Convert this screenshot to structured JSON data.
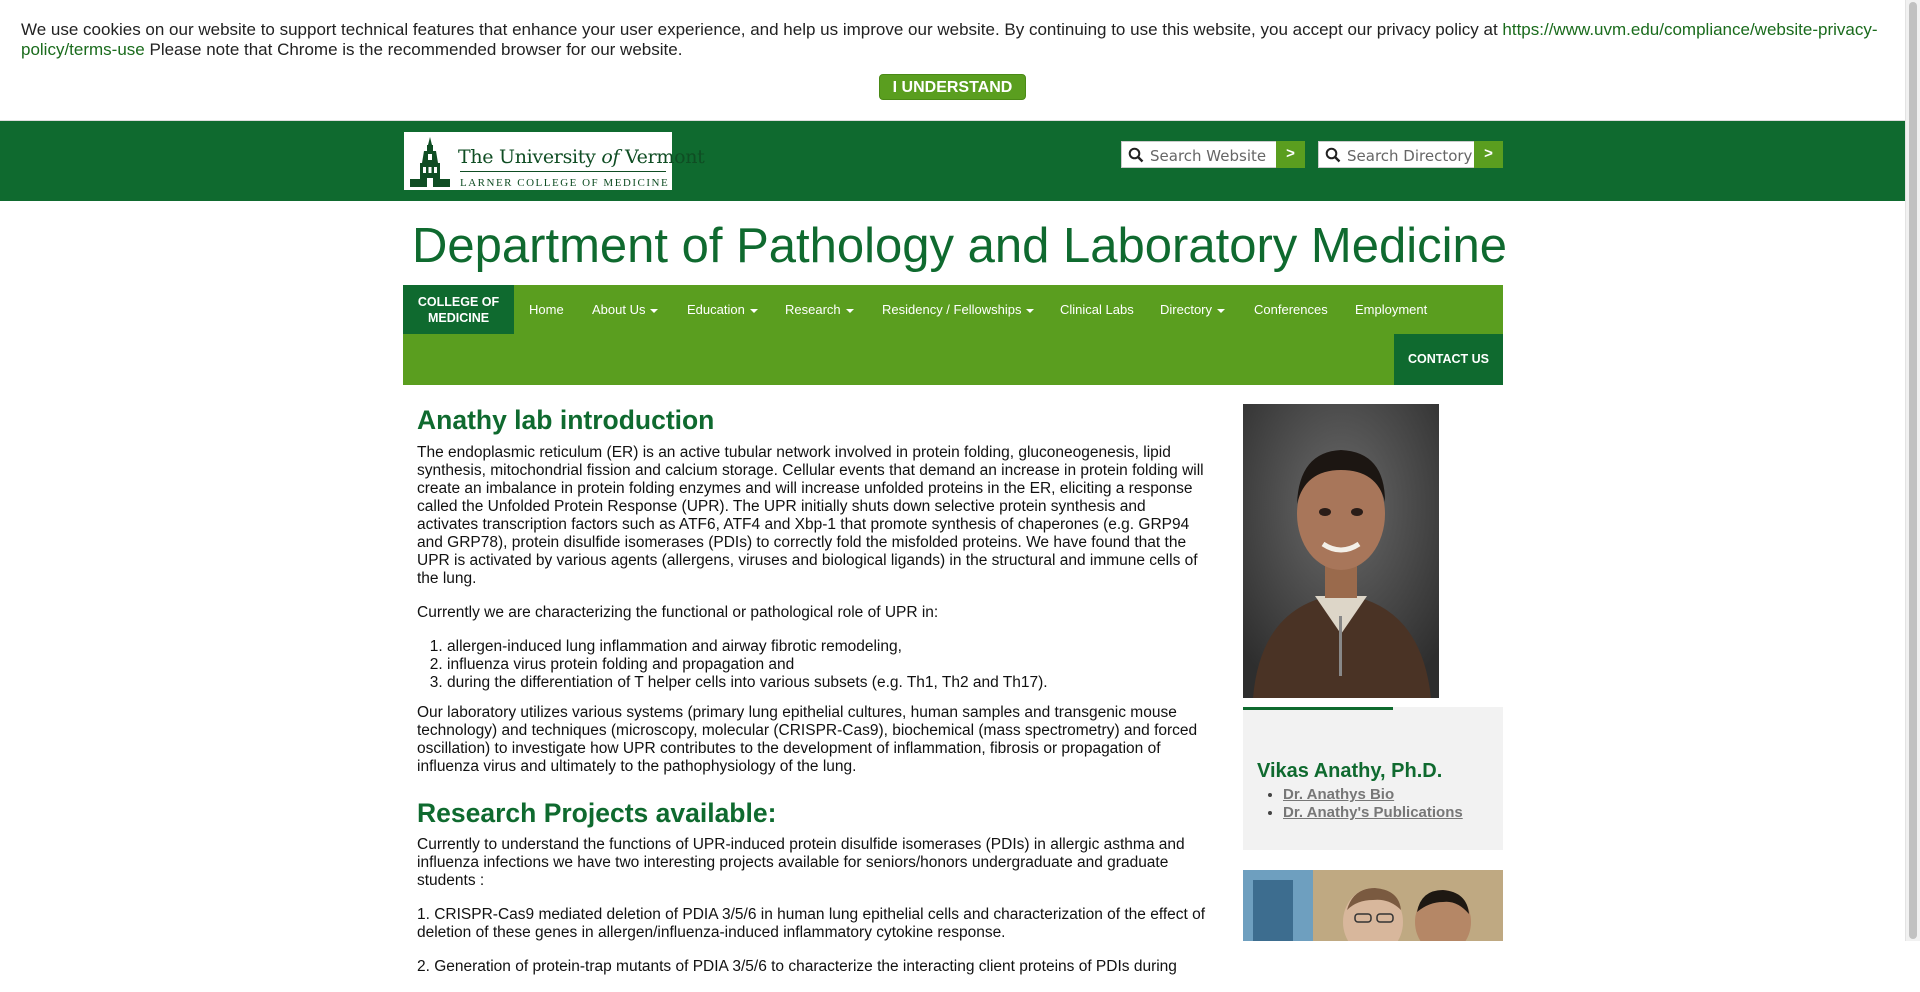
{
  "cookie": {
    "message": "We use cookies on our website to support technical features that enhance your user experience, and help us improve our website. By continuing to use this website, you accept our privacy policy at ",
    "link": "https://www.uvm.edu/compliance/website-privacy-policy/terms-use",
    "message_after": " Please note that Chrome is the recommended browser for our website.",
    "button": "I UNDERSTAND"
  },
  "header": {
    "logo_name_a": "The University ",
    "logo_name_of": "of",
    "logo_name_b": " Vermont",
    "logo_sub": "LARNER COLLEGE OF MEDICINE",
    "search_site_placeholder": "Search Website",
    "search_dir_placeholder": "Search Directory",
    "go_label": ">"
  },
  "department_title": "Department of Pathology and Laboratory Medicine",
  "nav": {
    "college_line1": "COLLEGE OF",
    "college_line2": "MEDICINE",
    "items": [
      {
        "label": "Home",
        "dropdown": false
      },
      {
        "label": "About Us",
        "dropdown": true
      },
      {
        "label": "Education",
        "dropdown": true
      },
      {
        "label": "Research",
        "dropdown": true
      },
      {
        "label": "Residency / Fellowships",
        "dropdown": true
      },
      {
        "label": "Clinical Labs",
        "dropdown": false
      },
      {
        "label": "Directory",
        "dropdown": true
      },
      {
        "label": "Conferences",
        "dropdown": false
      },
      {
        "label": "Employment",
        "dropdown": false
      }
    ],
    "contact": "CONTACT US"
  },
  "main": {
    "heading": "Anathy lab introduction",
    "intro": "The endoplasmic reticulum (ER) is an active tubular network involved in protein folding, gluconeogenesis, lipid synthesis, mitochondrial fission and calcium storage. Cellular events that demand an increase in protein folding will create an imbalance in protein folding enzymes and will increase unfolded proteins in the ER, eliciting a response called the Unfolded Protein Response (UPR). The UPR initially shuts down selective protein synthesis and activates transcription factors such as ATF6, ATF4 and Xbp-1 that promote synthesis of chaperones (e.g. GRP94 and GRP78), protein disulfide isomerases (PDIs) to correctly fold the misfolded proteins. We have found that the UPR is activated by various agents (allergens, viruses and biological ligands) in the structural and immune cells of the lung.",
    "characterizing": "Currently we are characterizing the functional or pathological role of UPR in:",
    "roles": [
      "allergen-induced lung inflammation and airway fibrotic remodeling,",
      " influenza virus protein folding and propagation and",
      " during the differentiation of T helper cells into various subsets (e.g. Th1, Th2 and Th17)."
    ],
    "systems": "Our laboratory utilizes various systems (primary lung epithelial cultures, human samples and transgenic mouse technology) and techniques (microscopy, molecular (CRISPR-Cas9), biochemical (mass spectrometry) and forced oscillation) to investigate how UPR contributes to the development of inflammation, fibrosis or propagation of influenza virus and ultimately to the pathophysiology of the lung.",
    "projects_heading": "Research Projects available:",
    "projects_intro": "Currently to understand the functions of UPR-induced protein disulfide isomerases (PDIs) in allergic asthma and influenza infections we have two interesting projects available for seniors/honors undergraduate and graduate students :",
    "project1": "1. CRISPR-Cas9 mediated deletion of PDIA 3/5/6 in human lung epithelial cells and characterization of the effect of deletion of these genes in allergen/influenza-induced inflammatory cytokine response.",
    "project2": "2. Generation of protein-trap mutants of PDIA 3/5/6 to characterize the interacting client proteins of PDIs during"
  },
  "sidebar": {
    "name": "Vikas Anathy, Ph.D.",
    "links": [
      "Dr. Anathys Bio",
      "Dr. Anathy's Publications"
    ]
  }
}
